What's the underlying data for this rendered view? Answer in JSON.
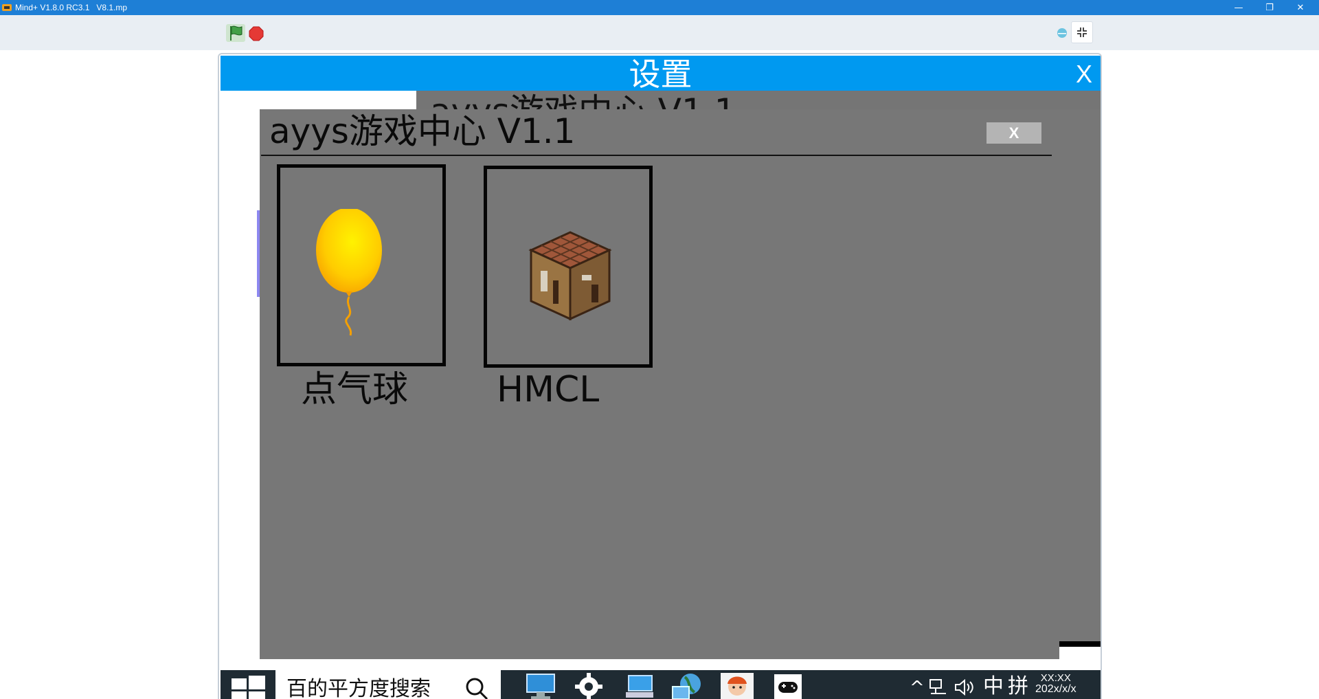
{
  "window": {
    "title": "Mind+ V1.8.0 RC3.1   V8.1.mp",
    "minimize_glyph": "—",
    "restore_glyph": "❐",
    "close_glyph": "✕"
  },
  "toolbar": {
    "start_icon": "green-flag-icon",
    "stop_icon": "stop-icon",
    "shrink_icon": "shrink-stage-icon"
  },
  "settings": {
    "title": "设置",
    "close_label": "X",
    "header_color": "#0099f0"
  },
  "game_center": {
    "background_title": "ayys游戏中心 V1.1",
    "title": "ayys游戏中心 V1.1",
    "close_label": "X",
    "background_color": "#777777",
    "games": [
      {
        "label": "点气球",
        "icon": "balloon-icon"
      },
      {
        "label": "HMCL",
        "icon": "crafting-table-icon"
      }
    ]
  },
  "taskbar": {
    "search_text": "百的平方度搜索",
    "apps": [
      "monitor-app-icon",
      "settings-gear-icon",
      "computer-app-icon",
      "globe-app-icon",
      "avatar-app-icon",
      "gamepad-app-icon"
    ],
    "tray": {
      "chevron": "^",
      "ime_lang": "中",
      "ime_mode": "拼",
      "time": "XX:XX",
      "date": "202x/x/x"
    }
  }
}
